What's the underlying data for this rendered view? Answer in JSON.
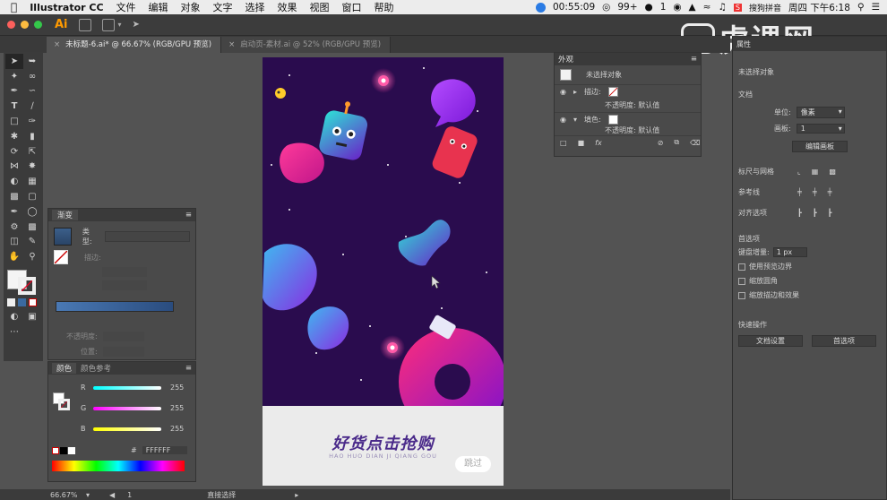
{
  "menubar": {
    "apple": "",
    "items": [
      "Illustrator CC",
      "文件",
      "编辑",
      "对象",
      "文字",
      "选择",
      "效果",
      "视图",
      "窗口",
      "帮助"
    ],
    "time": "00:55:09",
    "badge": "99+",
    "status_1": "1",
    "input_method": "搜狗拼音",
    "datetime": "周四 下午6:18"
  },
  "titlebar": {
    "logo": "Ai"
  },
  "tabs": [
    {
      "label": "未标题-6.ai* @ 66.67% (RGB/GPU 预览)",
      "active": true
    },
    {
      "label": "启动页-素材.ai @ 52% (RGB/GPU 预览)",
      "active": false
    }
  ],
  "watermark": {
    "text": "虎课网"
  },
  "gradient_panel": {
    "title": "渐变",
    "type_label": "类型:",
    "stroke_label": "描边:",
    "opacity_label": "不透明度:",
    "position_label": "位置:"
  },
  "color_panel": {
    "tab_color": "颜色",
    "tab_guide": "颜色参考",
    "r_label": "R",
    "g_label": "G",
    "b_label": "B",
    "r_value": "255",
    "g_value": "255",
    "b_value": "255",
    "hex_prefix": "#",
    "hex_value": "FFFFFF"
  },
  "appearance_panel": {
    "title": "外观",
    "no_selection": "未选择对象",
    "stroke_label": "描边:",
    "opacity_1": "不透明度: 默认值",
    "fill_label": "填色:",
    "opacity_2": "不透明度: 默认值"
  },
  "properties_panel": {
    "tab": "属性",
    "no_selection": "未选择对象",
    "document": "文档",
    "units_label": "单位:",
    "units_value": "像素",
    "artboard_label": "画板:",
    "artboard_value": "1",
    "edit_artboard": "编辑画板",
    "rulers_grids": "标尺与网格",
    "guides": "参考线",
    "align_snap": "对齐选项",
    "preferences": "首选项",
    "keyboard_increment_label": "键盘增量:",
    "keyboard_increment_value": "1 px",
    "checkbox_1": "使用预览边界",
    "checkbox_2": "缩放圆角",
    "checkbox_3": "缩放描边和效果",
    "quick_actions": "快速操作",
    "doc_setup": "文档设置",
    "prefs_button": "首选项"
  },
  "artboard": {
    "cta_title": "好货点击抢购",
    "cta_sub": "HAO HUO DIAN JI QIANG GOU",
    "skip": "跳过"
  },
  "statusbar": {
    "zoom": "66.67%",
    "page": "1",
    "tool": "直接选择"
  },
  "colors": {
    "artboard_bg": "#2a0c4e",
    "accent_pink": "#ff2d8a",
    "accent_purple": "#7b2ff7",
    "cta_text": "#4a2a8a"
  }
}
